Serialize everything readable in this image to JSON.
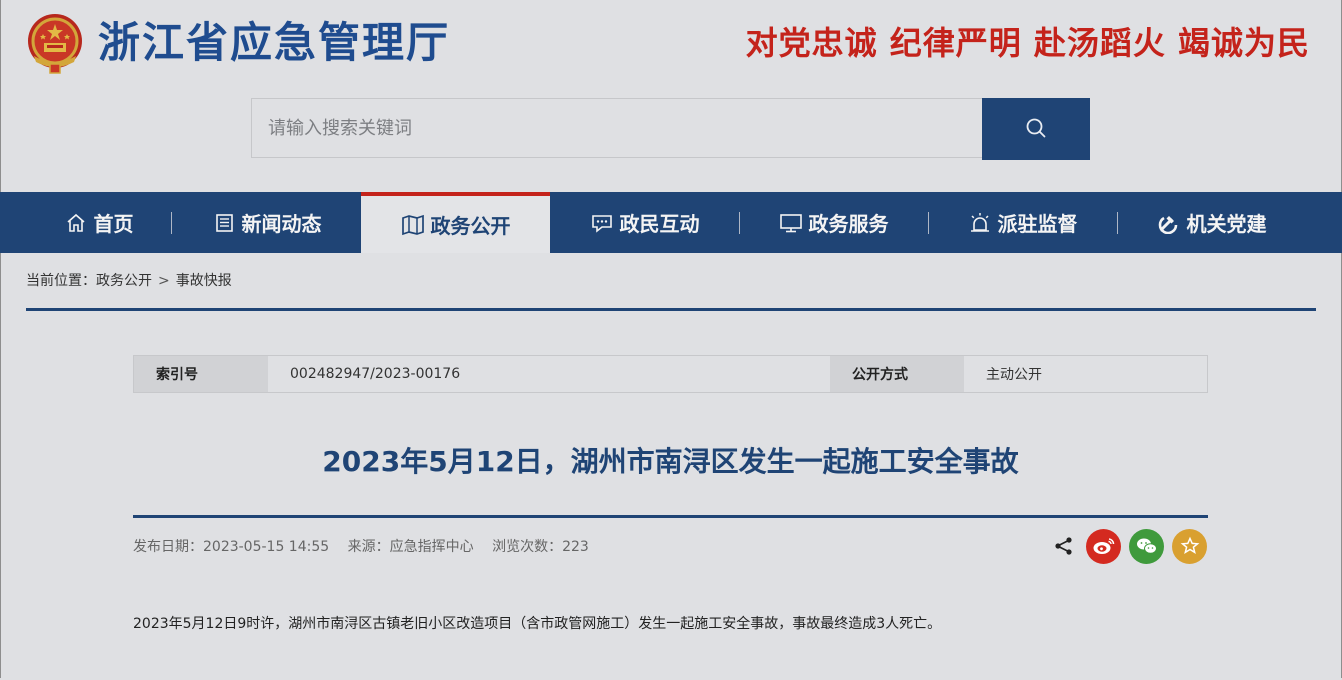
{
  "header": {
    "site_title": "浙江省应急管理厅",
    "slogan": "对党忠诚 纪律严明 赴汤蹈火 竭诚为民",
    "emblem_icon": "national-emblem-icon"
  },
  "search": {
    "placeholder": "请输入搜索关键词",
    "button_icon": "search-icon"
  },
  "nav": {
    "items": [
      {
        "label": "首页",
        "icon": "home-icon"
      },
      {
        "label": "新闻动态",
        "icon": "newspaper-icon"
      },
      {
        "label": "政务公开",
        "icon": "book-map-icon",
        "active": true
      },
      {
        "label": "政民互动",
        "icon": "chat-icon"
      },
      {
        "label": "政务服务",
        "icon": "monitor-icon"
      },
      {
        "label": "派驻监督",
        "icon": "siren-icon"
      },
      {
        "label": "机关党建",
        "icon": "party-emblem-icon"
      }
    ]
  },
  "breadcrumb": {
    "prefix": "当前位置：",
    "items": [
      "政务公开",
      "事故快报"
    ],
    "separator": ">"
  },
  "info_table": {
    "index_label": "索引号",
    "index_value": "002482947/2023-00176",
    "mode_label": "公开方式",
    "mode_value": "主动公开"
  },
  "article": {
    "title": "2023年5月12日，湖州市南浔区发生一起施工安全事故",
    "publish_date": "发布日期：2023-05-15 14:55",
    "source": "来源：应急指挥中心",
    "views": "浏览次数：223",
    "body": "2023年5月12日9时许，湖州市南浔区古镇老旧小区改造项目（含市政管网施工）发生一起施工安全事故，事故最终造成3人死亡。"
  },
  "share": {
    "icons": [
      "share-icon",
      "weibo-icon",
      "wechat-icon",
      "favorite-star-icon"
    ]
  },
  "colors": {
    "brand_blue": "#1f4475",
    "title_blue": "#1f4c8f",
    "slogan_red": "#c4231b",
    "weibo_red": "#d42a20",
    "wechat_green": "#3f9a3c",
    "favorite_gold": "#d9a030"
  }
}
